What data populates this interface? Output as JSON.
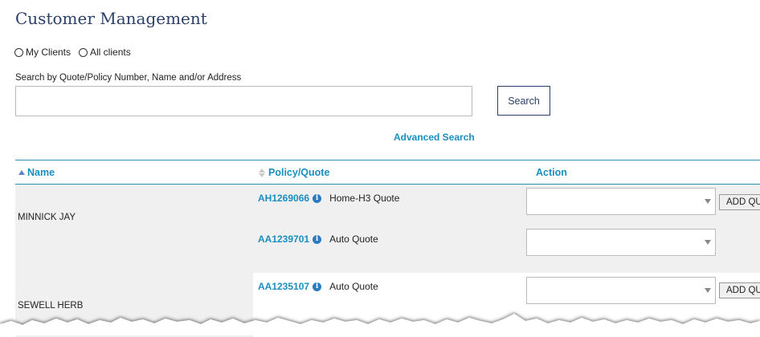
{
  "page": {
    "title": "Customer Management"
  },
  "filters": {
    "my_clients": "My Clients",
    "all_clients": "All clients"
  },
  "search": {
    "label": "Search by Quote/Policy Number, Name and/or Address",
    "value": "",
    "button": "Search",
    "advanced": "Advanced Search"
  },
  "table": {
    "headers": {
      "name": "Name",
      "policy": "Policy/Quote",
      "action": "Action"
    },
    "rows": [
      {
        "name": "MINNICK JAY",
        "policies": [
          {
            "number": "AH1269066",
            "type": "Home-H3 Quote",
            "button": "ADD QUOTE"
          },
          {
            "number": "AA1239701",
            "type": "Auto Quote"
          }
        ]
      },
      {
        "name": "SEWELL HERB",
        "policies": [
          {
            "number": "AA1235107",
            "type": "Auto Quote",
            "button": "ADD QUOTE"
          }
        ]
      }
    ]
  },
  "colors": {
    "navy": "#2b3f6b",
    "link": "#1a8fbf",
    "info": "#2b7bbf"
  }
}
